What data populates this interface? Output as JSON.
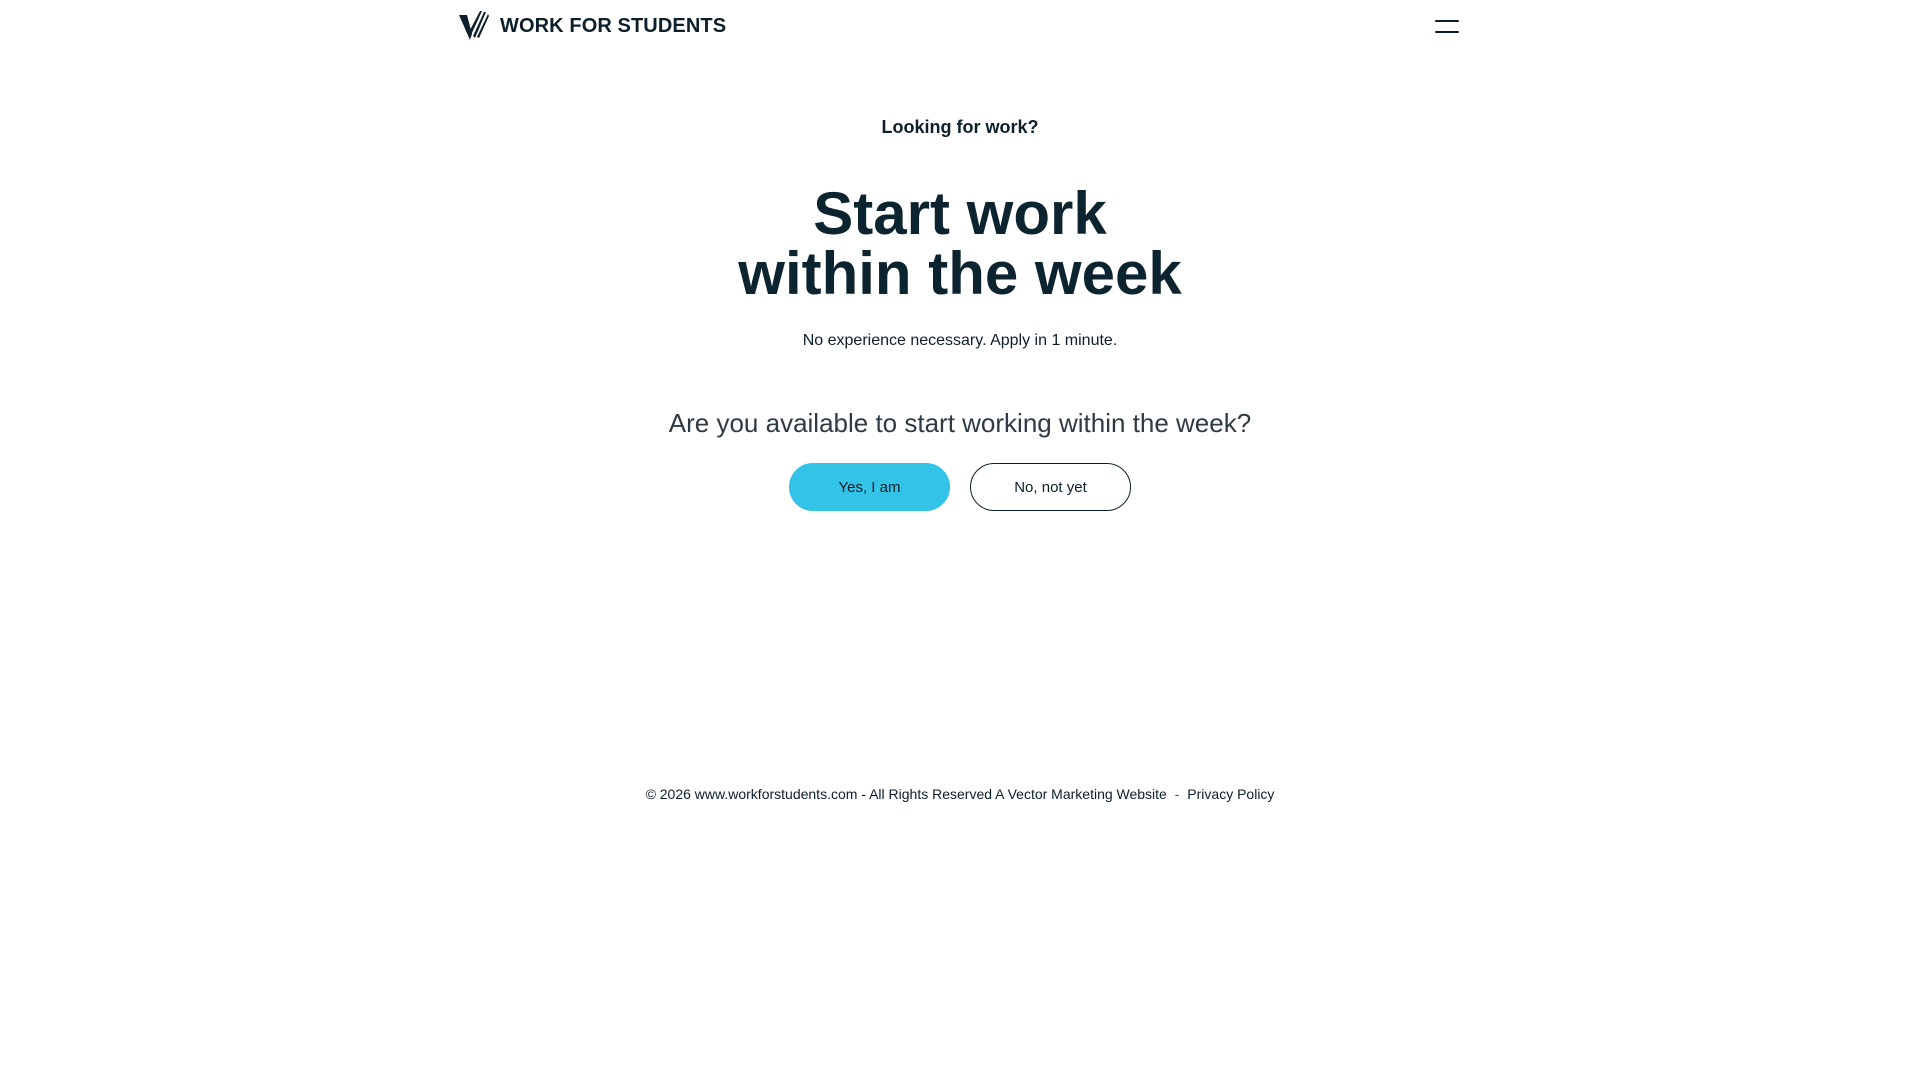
{
  "header": {
    "brand_name": "WORK FOR STUDENTS",
    "logo_icon": "vector-v-logo-icon",
    "menu_icon": "hamburger-menu-icon"
  },
  "hero": {
    "eyebrow": "Looking for work?",
    "headline_line1": "Start work",
    "headline_line2": "within the week",
    "subtext": "No experience necessary. Apply in 1 minute."
  },
  "question": {
    "text": "Are you available to start working within the week?",
    "yes_label": "Yes, I am",
    "no_label": "No, not yet"
  },
  "footer": {
    "copyright": "© 2026 www.workforstudents.com - All Rights Reserved A Vector Marketing Website",
    "separator": "-",
    "privacy_label": "Privacy Policy"
  },
  "colors": {
    "primary_text": "#0d1f2a",
    "accent": "#33c3e6",
    "background": "#ffffff"
  }
}
